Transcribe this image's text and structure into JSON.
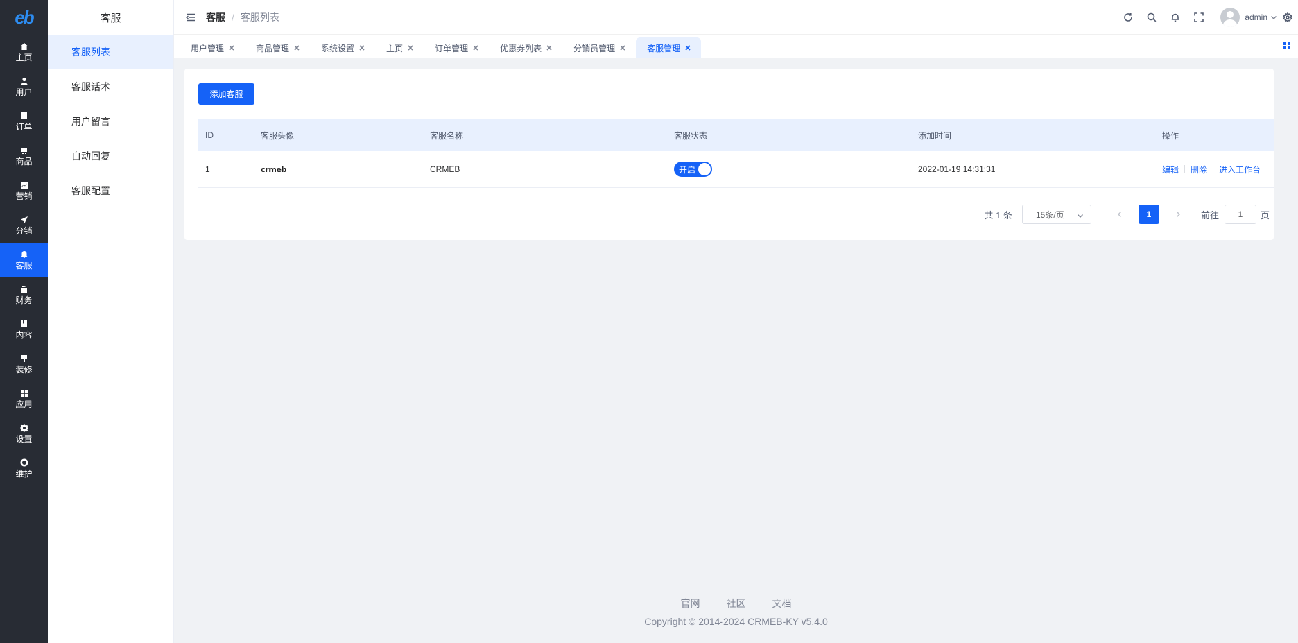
{
  "rail": {
    "items": [
      {
        "label": "主页",
        "icon": "home-icon"
      },
      {
        "label": "用户",
        "icon": "user-icon"
      },
      {
        "label": "订单",
        "icon": "order-icon"
      },
      {
        "label": "商品",
        "icon": "goods-icon"
      },
      {
        "label": "营销",
        "icon": "marketing-icon"
      },
      {
        "label": "分销",
        "icon": "distribution-icon"
      },
      {
        "label": "客服",
        "icon": "service-icon"
      },
      {
        "label": "财务",
        "icon": "finance-icon"
      },
      {
        "label": "内容",
        "icon": "content-icon"
      },
      {
        "label": "装修",
        "icon": "decoration-icon"
      },
      {
        "label": "应用",
        "icon": "apps-icon"
      },
      {
        "label": "设置",
        "icon": "settings-icon"
      },
      {
        "label": "维护",
        "icon": "maintenance-icon"
      }
    ],
    "active_index": 6,
    "active_color": "#1562f7"
  },
  "submenu": {
    "title": "客服",
    "items": [
      "客服列表",
      "客服话术",
      "用户留言",
      "自动回复",
      "客服配置"
    ],
    "active_index": 0
  },
  "header": {
    "breadcrumb": [
      "客服",
      "客服列表"
    ],
    "username": "admin"
  },
  "tabs": {
    "items": [
      "用户管理",
      "商品管理",
      "系统设置",
      "主页",
      "订单管理",
      "优惠券列表",
      "分销员管理",
      "客服管理"
    ],
    "active_index": 7
  },
  "toolbar": {
    "add_label": "添加客服"
  },
  "table": {
    "columns": [
      "ID",
      "客服头像",
      "客服名称",
      "客服状态",
      "添加时间",
      "操作"
    ],
    "rows": [
      {
        "id": "1",
        "avatar_text": "crmeb",
        "name": "CRMEB",
        "status_label": "开启",
        "status_on": true,
        "time": "2022-01-19 14:31:31",
        "ops": [
          "编辑",
          "删除",
          "进入工作台"
        ]
      }
    ]
  },
  "pagination": {
    "total": "共 1 条",
    "page_size": "15条/页",
    "current": "1",
    "goto_prefix": "前往",
    "goto_value": "1",
    "goto_suffix": "页"
  },
  "footer": {
    "links": [
      "官网",
      "社区",
      "文档"
    ],
    "copyright": "Copyright © 2014-2024 CRMEB-KY v5.4.0"
  }
}
